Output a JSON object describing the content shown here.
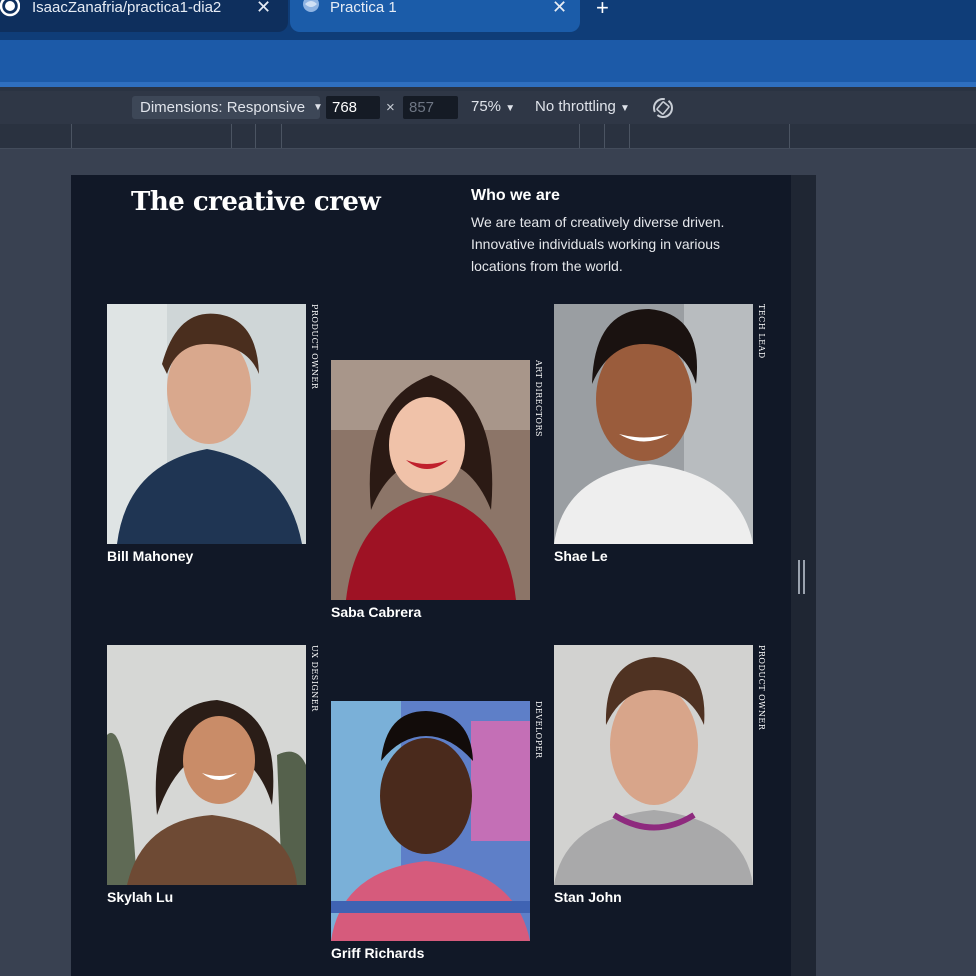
{
  "browser": {
    "tabs": [
      {
        "title": "IsaacZanafria/practica1-dia2",
        "icon": "github-icon"
      },
      {
        "title": "Practica 1",
        "icon": "globe-icon"
      }
    ],
    "new_tab_label": "+"
  },
  "devtools": {
    "dimensions_label": "Dimensions: Responsive",
    "width": "768",
    "height": "857",
    "separator": "×",
    "zoom": "75%",
    "throttling": "No throttling"
  },
  "page": {
    "title": "The creative crew",
    "subtitle": "Who we are",
    "intro": "We are team of creatively diverse driven. Innovative individuals working in various locations from the world.",
    "members": [
      {
        "name": "Bill Mahoney",
        "role": "PRODUCT OWNER",
        "photo_colors": [
          "#cfd6d7",
          "#1f3553",
          "#d9a88d"
        ]
      },
      {
        "name": "Saba Cabrera",
        "role": "ART DIRECTORS",
        "photo_colors": [
          "#8c7568",
          "#9e1224",
          "#f0c2a9"
        ]
      },
      {
        "name": "Shae Le",
        "role": "TECH LEAD",
        "photo_colors": [
          "#9a9ea2",
          "#eeeeee",
          "#9a5c3c"
        ]
      },
      {
        "name": "Skylah Lu",
        "role": "UX DESIGNER",
        "photo_colors": [
          "#d6d7d5",
          "#6e4a34",
          "#c98c68"
        ]
      },
      {
        "name": "Griff Richards",
        "role": "DEVELOPER",
        "photo_colors": [
          "#5e7fc8",
          "#d65b7c",
          "#4a2a1c"
        ]
      },
      {
        "name": "Stan John",
        "role": "PRODUCT OWNER",
        "photo_colors": [
          "#d2d2d0",
          "#a9a9aa",
          "#d8a58a"
        ]
      }
    ]
  }
}
